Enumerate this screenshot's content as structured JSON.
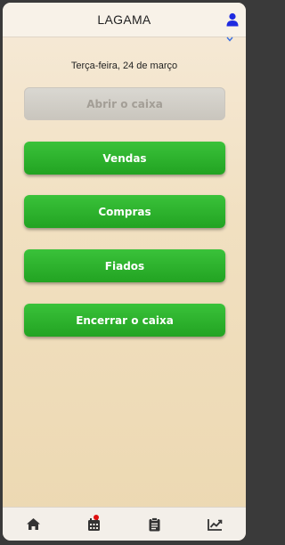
{
  "header": {
    "title": "LAGAMA",
    "user_icon": "user-icon"
  },
  "date_text": "Terça-feira, 24 de março",
  "buttons": {
    "open_cash": "Abrir o caixa",
    "sales": "Vendas",
    "purchases": "Compras",
    "credits": "Fiados",
    "close_cash": "Encerrar o caixa"
  },
  "nav": {
    "items": [
      "home-icon",
      "calendar-icon",
      "clipboard-icon",
      "chart-line-icon"
    ]
  },
  "colors": {
    "accent": "#2db52d",
    "badge": "#e01010",
    "user_icon": "#1f2be0"
  }
}
